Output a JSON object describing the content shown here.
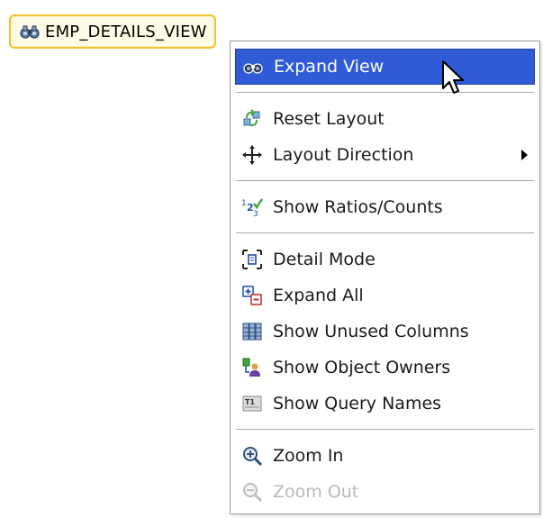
{
  "node": {
    "label": "EMP_DETAILS_VIEW",
    "icon": "view-binoculars-icon",
    "border_color": "#f0c233",
    "fill_color": "#fffbe6"
  },
  "menu": {
    "highlight_color": "#2f5bd6",
    "items": [
      {
        "label": "Expand View",
        "icon": "expand-view-icon",
        "highlighted": true,
        "enabled": true
      },
      {
        "label": "Reset Layout",
        "icon": "reset-layout-icon",
        "enabled": true
      },
      {
        "label": "Layout Direction",
        "icon": "layout-direction-icon",
        "enabled": true,
        "has_submenu": true
      },
      {
        "label": "Show Ratios/Counts",
        "icon": "ratios-counts-icon",
        "enabled": true
      },
      {
        "label": "Detail Mode",
        "icon": "detail-mode-icon",
        "enabled": true
      },
      {
        "label": "Expand All",
        "icon": "expand-all-icon",
        "enabled": true
      },
      {
        "label": "Show Unused Columns",
        "icon": "unused-columns-icon",
        "enabled": true
      },
      {
        "label": "Show Object Owners",
        "icon": "object-owners-icon",
        "enabled": true
      },
      {
        "label": "Show Query Names",
        "icon": "query-names-icon",
        "enabled": true
      },
      {
        "label": "Zoom In",
        "icon": "zoom-in-icon",
        "enabled": true
      },
      {
        "label": "Zoom Out",
        "icon": "zoom-out-icon",
        "enabled": false
      }
    ]
  }
}
